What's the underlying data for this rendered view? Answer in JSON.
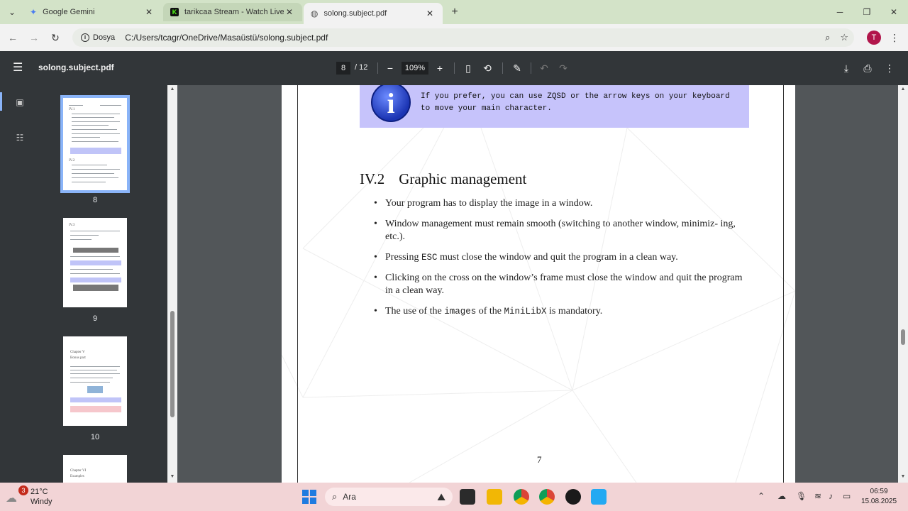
{
  "browser": {
    "tabs": [
      {
        "title": "Google Gemini",
        "icon": "gemini-icon"
      },
      {
        "title": "tarikcaa Stream - Watch Live on",
        "icon": "kick-icon"
      },
      {
        "title": "solong.subject.pdf",
        "icon": "globe-icon"
      }
    ],
    "address": {
      "chip_label": "Dosya",
      "url": "C:/Users/tcagr/OneDrive/Masaüstü/solong.subject.pdf"
    },
    "avatar_letter": "T"
  },
  "pdf_toolbar": {
    "title": "solong.subject.pdf",
    "current_page": "8",
    "total_pages": "/ 12",
    "zoom": "109%"
  },
  "thumbnails": [
    {
      "label": "8",
      "selected": true
    },
    {
      "label": "9",
      "selected": false
    },
    {
      "label": "10",
      "selected": false
    }
  ],
  "document": {
    "info_text": "If you prefer, you can use ZQSD or the arrow keys on your keyboard to move your main character.",
    "section_number": "IV.2",
    "section_title": "Graphic management",
    "bullets": [
      {
        "parts": [
          {
            "t": "Your program has to display the image in a window."
          }
        ]
      },
      {
        "parts": [
          {
            "t": "Window management must remain smooth (switching to another window, minimiz- ing, etc.)."
          }
        ]
      },
      {
        "parts": [
          {
            "t": "Pressing "
          },
          {
            "t": "ESC",
            "mono": true
          },
          {
            "t": " must close the window and quit the program in a clean way."
          }
        ]
      },
      {
        "parts": [
          {
            "t": "Clicking on the cross on the window’s frame must close the window and quit the program in a clean way."
          }
        ]
      },
      {
        "parts": [
          {
            "t": "The use of the "
          },
          {
            "t": "images",
            "mono": true
          },
          {
            "t": " of the "
          },
          {
            "t": "MiniLibX",
            "mono": true
          },
          {
            "t": " is mandatory."
          }
        ]
      }
    ],
    "page_number": "7"
  },
  "taskbar": {
    "weather_badge": "3",
    "temperature": "21°C",
    "condition": "Windy",
    "search_label": "Ara",
    "time": "06:59",
    "date": "15.08.2025"
  },
  "colors": {
    "tabstrip": "#d3e3c8",
    "pdf_chrome": "#323639",
    "info_box": "#c6c3fb",
    "selection": "#8ab4f8",
    "taskbar": "#f2d4d6"
  }
}
